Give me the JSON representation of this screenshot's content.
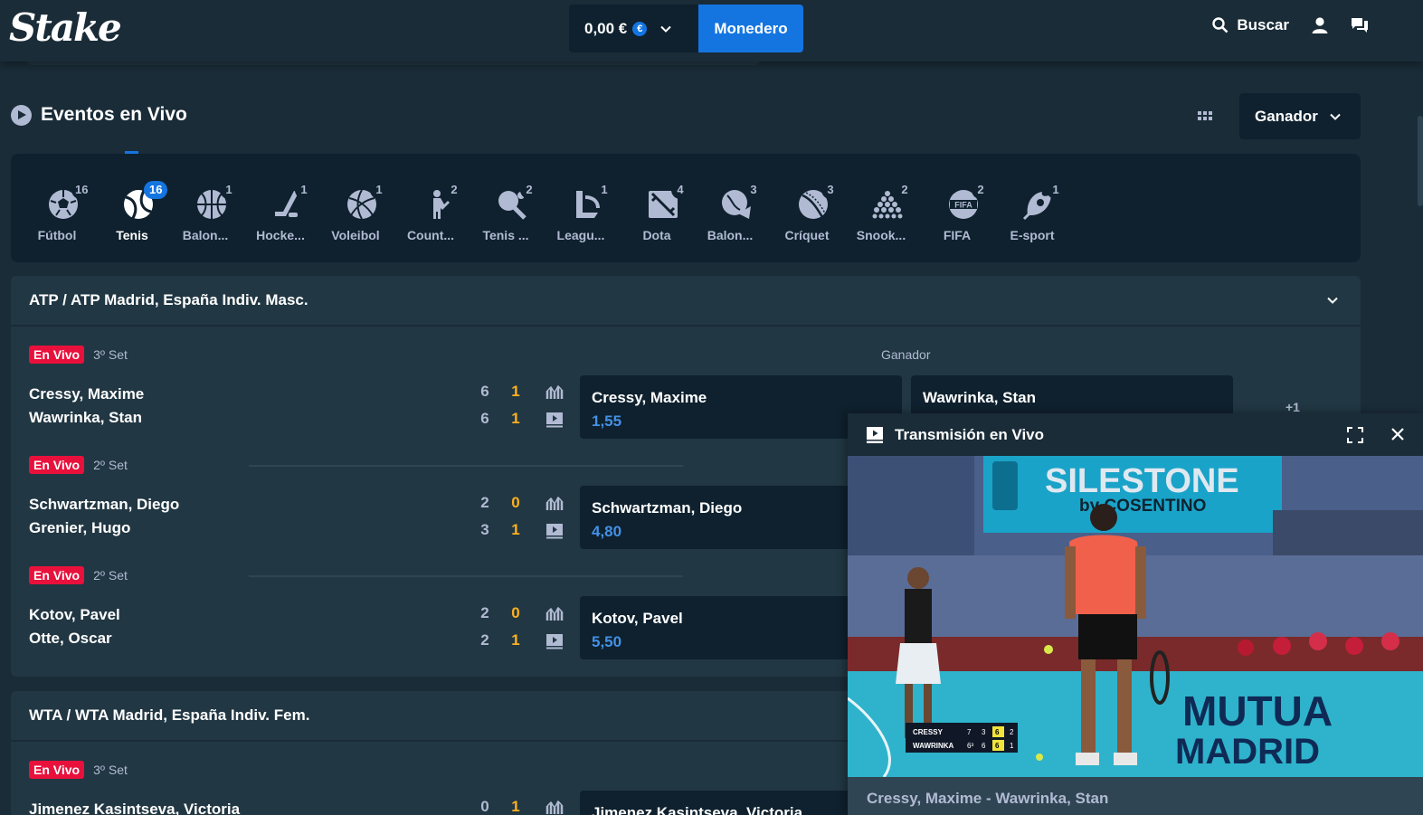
{
  "header": {
    "logo": "Stake",
    "balance": "0,00 €",
    "currency_symbol": "€",
    "wallet_button": "Monedero",
    "search_label": "Buscar"
  },
  "section": {
    "title": "Eventos en Vivo",
    "market_dropdown": "Ganador"
  },
  "sports": [
    {
      "label": "Fútbol",
      "count": "16",
      "icon": "football-icon"
    },
    {
      "label": "Tenis",
      "count": "16",
      "icon": "tennis-icon",
      "active": true
    },
    {
      "label": "Balon...",
      "count": "1",
      "icon": "basketball-icon"
    },
    {
      "label": "Hocke...",
      "count": "1",
      "icon": "hockey-icon"
    },
    {
      "label": "Voleibol",
      "count": "1",
      "icon": "volleyball-icon"
    },
    {
      "label": "Count...",
      "count": "2",
      "icon": "counter-strike-icon"
    },
    {
      "label": "Tenis ...",
      "count": "2",
      "icon": "table-tennis-icon"
    },
    {
      "label": "Leagu...",
      "count": "1",
      "icon": "league-of-legends-icon"
    },
    {
      "label": "Dota",
      "count": "4",
      "icon": "dota-icon"
    },
    {
      "label": "Balon...",
      "count": "3",
      "icon": "handball-icon"
    },
    {
      "label": "Críquet",
      "count": "3",
      "icon": "cricket-icon"
    },
    {
      "label": "Snook...",
      "count": "2",
      "icon": "snooker-icon"
    },
    {
      "label": "FIFA",
      "count": "2",
      "icon": "fifa-icon"
    },
    {
      "label": "E-sport",
      "count": "1",
      "icon": "esport-icon"
    }
  ],
  "tournaments": [
    {
      "title": "ATP / ATP Madrid, España Indiv. Masc.",
      "market_label": "Ganador",
      "matches": [
        {
          "status": "En Vivo",
          "set": "3º Set",
          "p1": "Cressy, Maxime",
          "p2": "Wawrinka, Stan",
          "s1a": "6",
          "s1b": "1",
          "s2a": "6",
          "s2b": "1",
          "odd1_name": "Cressy, Maxime",
          "odd1": "1,55",
          "odd2_name": "Wawrinka, Stan",
          "more": "+1"
        },
        {
          "status": "En Vivo",
          "set": "2º Set",
          "p1": "Schwartzman, Diego",
          "p2": "Grenier, Hugo",
          "s1a": "2",
          "s1b": "0",
          "s2a": "3",
          "s2b": "1",
          "odd1_name": "Schwartzman, Diego",
          "odd1": "4,80"
        },
        {
          "status": "En Vivo",
          "set": "2º Set",
          "p1": "Kotov, Pavel",
          "p2": "Otte, Oscar",
          "s1a": "2",
          "s1b": "0",
          "s2a": "2",
          "s2b": "1",
          "odd1_name": "Kotov, Pavel",
          "odd1": "5,50"
        }
      ]
    },
    {
      "title": "WTA / WTA Madrid, España Indiv. Fem.",
      "matches": [
        {
          "status": "En Vivo",
          "set": "3º Set",
          "p1": "Jimenez Kasintseva, Victoria",
          "s1a": "0",
          "s1b": "1",
          "odd1_name": "Jimenez Kasintseva, Victoria"
        }
      ]
    }
  ],
  "stream": {
    "title": "Transmisión en Vivo",
    "caption": "Cressy, Maxime - Wawrinka, Stan",
    "banner_top": "SILESTONE",
    "banner_sub": "by COSENTINO",
    "banner_bottom_1": "MUTUA",
    "banner_bottom_2": "MADRID",
    "scoreboard": [
      {
        "name": "CRESSY",
        "sets": [
          "7",
          "3",
          "6",
          "2"
        ]
      },
      {
        "name": "WAWRINKA",
        "sets": [
          "6³",
          "6",
          "6",
          "1"
        ]
      }
    ]
  },
  "colors": {
    "bg": "#1a2c38",
    "panel": "#213743",
    "dark": "#0f212e",
    "accent": "#1475e1",
    "live": "#e9113c",
    "odds": "#4391e7",
    "score_current": "#ffb01f"
  }
}
